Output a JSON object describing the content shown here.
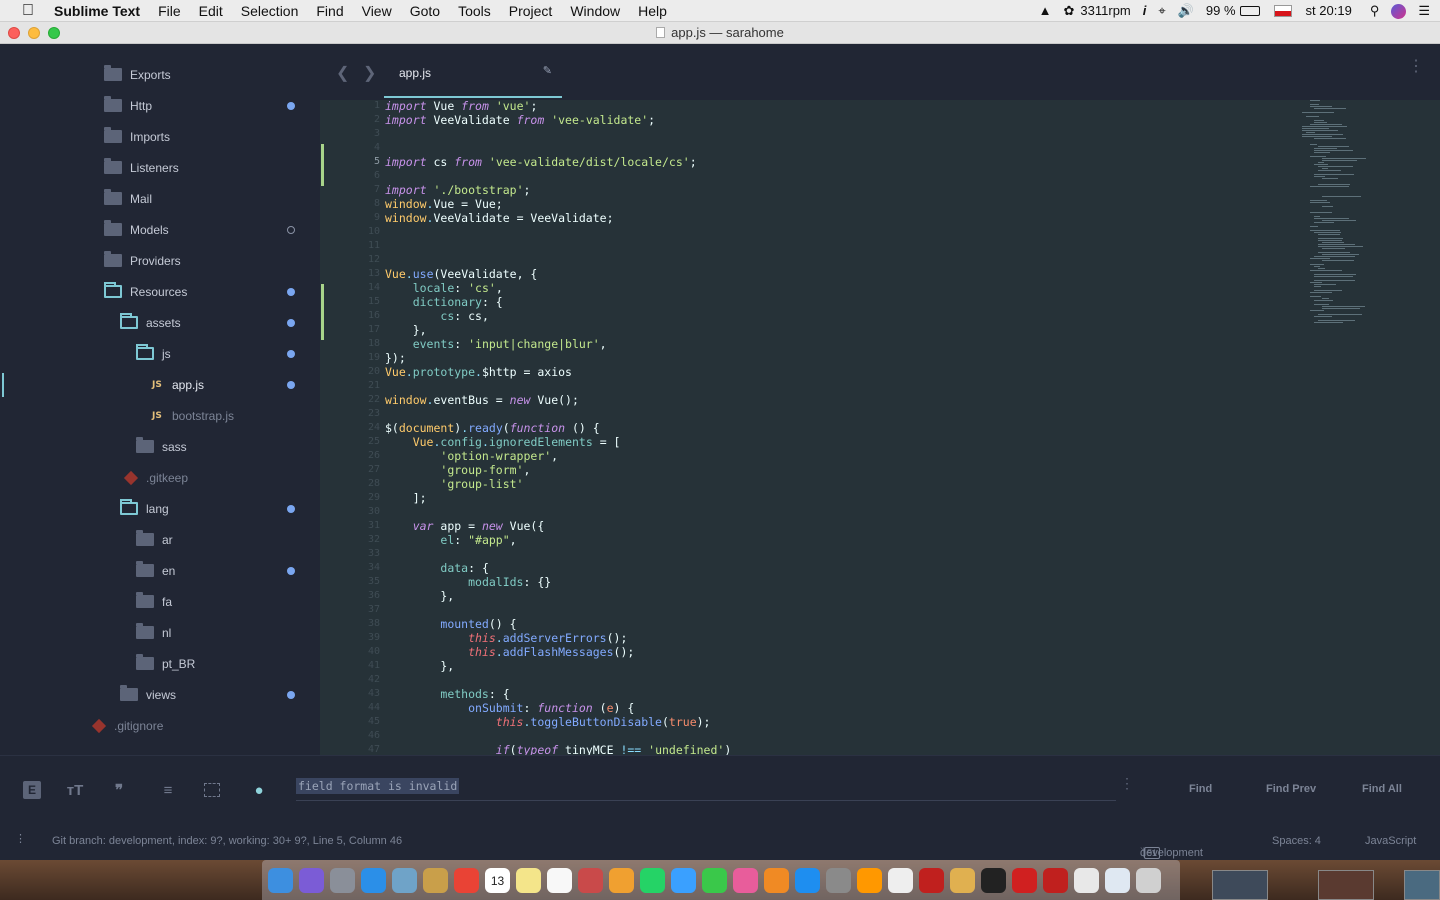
{
  "menubar": {
    "app_name": "Sublime Text",
    "items": [
      "File",
      "Edit",
      "Selection",
      "Find",
      "View",
      "Goto",
      "Tools",
      "Project",
      "Window",
      "Help"
    ],
    "fan_speed": "3311rpm",
    "battery": "99 %",
    "clock": "st 20:19"
  },
  "window": {
    "title": "app.js — sarahome"
  },
  "sidebar": {
    "items": [
      {
        "label": "Exports",
        "type": "folder",
        "depth": 0,
        "dot": ""
      },
      {
        "label": "Http",
        "type": "folder",
        "depth": 0,
        "dot": "filled"
      },
      {
        "label": "Imports",
        "type": "folder",
        "depth": 0,
        "dot": ""
      },
      {
        "label": "Listeners",
        "type": "folder",
        "depth": 0,
        "dot": ""
      },
      {
        "label": "Mail",
        "type": "folder",
        "depth": 0,
        "dot": ""
      },
      {
        "label": "Models",
        "type": "folder",
        "depth": 0,
        "dot": "hollow"
      },
      {
        "label": "Providers",
        "type": "folder",
        "depth": 0,
        "dot": ""
      },
      {
        "label": "Resources",
        "type": "folder-open",
        "depth": 0,
        "dot": "filled"
      },
      {
        "label": "assets",
        "type": "folder-open",
        "depth": 1,
        "dot": "filled"
      },
      {
        "label": "js",
        "type": "folder-open",
        "depth": 2,
        "dot": "filled"
      },
      {
        "label": "app.js",
        "type": "js",
        "depth": 3,
        "dot": "filled",
        "active": true
      },
      {
        "label": "bootstrap.js",
        "type": "js",
        "depth": 3,
        "dot": "",
        "dim": true
      },
      {
        "label": "sass",
        "type": "folder",
        "depth": 2,
        "dot": ""
      },
      {
        "label": ".gitkeep",
        "type": "git",
        "depth": 2,
        "dot": "",
        "dim": true
      },
      {
        "label": "lang",
        "type": "folder-open",
        "depth": 1,
        "dot": "filled"
      },
      {
        "label": "ar",
        "type": "folder",
        "depth": 2,
        "dot": ""
      },
      {
        "label": "en",
        "type": "folder",
        "depth": 2,
        "dot": "filled"
      },
      {
        "label": "fa",
        "type": "folder",
        "depth": 2,
        "dot": ""
      },
      {
        "label": "nl",
        "type": "folder",
        "depth": 2,
        "dot": ""
      },
      {
        "label": "pt_BR",
        "type": "folder",
        "depth": 2,
        "dot": ""
      },
      {
        "label": "views",
        "type": "folder",
        "depth": 1,
        "dot": "filled"
      },
      {
        "label": ".gitignore",
        "type": "git",
        "depth": 0,
        "dot": "",
        "dim": true
      }
    ]
  },
  "tabs": {
    "active": "app.js"
  },
  "editor": {
    "current_line": 5,
    "modified_lines": [
      4,
      5,
      6,
      14,
      15,
      16,
      17
    ],
    "lines": [
      [
        [
          "kw",
          "import"
        ],
        [
          "",
          " Vue "
        ],
        [
          "kw",
          "from"
        ],
        [
          "",
          " "
        ],
        [
          "str",
          "'vue'"
        ],
        [
          "",
          ";"
        ]
      ],
      [
        [
          "kw",
          "import"
        ],
        [
          "",
          " VeeValidate "
        ],
        [
          "kw",
          "from"
        ],
        [
          "",
          " "
        ],
        [
          "str",
          "'vee-validate'"
        ],
        [
          "",
          ";"
        ]
      ],
      [],
      [],
      [
        [
          "kw",
          "import"
        ],
        [
          "",
          " cs "
        ],
        [
          "kw",
          "from"
        ],
        [
          "",
          " "
        ],
        [
          "str",
          "'vee-validate/dist/locale/cs'"
        ],
        [
          "",
          ";"
        ]
      ],
      [],
      [
        [
          "kw",
          "import"
        ],
        [
          "",
          " "
        ],
        [
          "str",
          "'./bootstrap'"
        ],
        [
          "",
          ";"
        ]
      ],
      [
        [
          "obj",
          "window"
        ],
        [
          "pun",
          "."
        ],
        [
          "",
          "Vue = Vue;"
        ]
      ],
      [
        [
          "obj",
          "window"
        ],
        [
          "pun",
          "."
        ],
        [
          "",
          "VeeValidate = VeeValidate;"
        ]
      ],
      [],
      [],
      [],
      [
        [
          "obj",
          "Vue"
        ],
        [
          "pun",
          "."
        ],
        [
          "fn",
          "use"
        ],
        [
          "",
          "(VeeValidate, {"
        ]
      ],
      [
        [
          "",
          "    "
        ],
        [
          "prop",
          "locale"
        ],
        [
          "",
          ": "
        ],
        [
          "str",
          "'cs'"
        ],
        [
          "",
          ","
        ]
      ],
      [
        [
          "",
          "    "
        ],
        [
          "prop",
          "dictionary"
        ],
        [
          "",
          ": {"
        ]
      ],
      [
        [
          "",
          "        "
        ],
        [
          "prop",
          "cs"
        ],
        [
          "",
          ": cs,"
        ]
      ],
      [
        [
          "",
          "    },"
        ]
      ],
      [
        [
          "",
          "    "
        ],
        [
          "prop",
          "events"
        ],
        [
          "",
          ": "
        ],
        [
          "str",
          "'input|change|blur'"
        ],
        [
          "",
          ","
        ]
      ],
      [
        [
          "",
          "});"
        ]
      ],
      [
        [
          "obj",
          "Vue"
        ],
        [
          "pun",
          "."
        ],
        [
          "prop",
          "prototype"
        ],
        [
          "pun",
          "."
        ],
        [
          "",
          "$http = axios"
        ]
      ],
      [],
      [
        [
          "obj",
          "window"
        ],
        [
          "pun",
          "."
        ],
        [
          "",
          "eventBus = "
        ],
        [
          "kw",
          "new"
        ],
        [
          "",
          " Vue();"
        ]
      ],
      [],
      [
        [
          "",
          "$("
        ],
        [
          "obj",
          "document"
        ],
        [
          "",
          ")"
        ],
        [
          "pun",
          "."
        ],
        [
          "fn",
          "ready"
        ],
        [
          "",
          "("
        ],
        [
          "kw",
          "function"
        ],
        [
          "",
          " () {"
        ]
      ],
      [
        [
          "",
          "    "
        ],
        [
          "obj",
          "Vue"
        ],
        [
          "pun",
          "."
        ],
        [
          "prop",
          "config"
        ],
        [
          "pun",
          "."
        ],
        [
          "prop",
          "ignoredElements"
        ],
        [
          "",
          " = ["
        ]
      ],
      [
        [
          "",
          "        "
        ],
        [
          "str",
          "'option-wrapper'"
        ],
        [
          "",
          ","
        ]
      ],
      [
        [
          "",
          "        "
        ],
        [
          "str",
          "'group-form'"
        ],
        [
          "",
          ","
        ]
      ],
      [
        [
          "",
          "        "
        ],
        [
          "str",
          "'group-list'"
        ]
      ],
      [
        [
          "",
          "    ];"
        ]
      ],
      [],
      [
        [
          "",
          "    "
        ],
        [
          "kw",
          "var"
        ],
        [
          "",
          " app = "
        ],
        [
          "kw",
          "new"
        ],
        [
          "",
          " Vue({"
        ]
      ],
      [
        [
          "",
          "        "
        ],
        [
          "prop",
          "el"
        ],
        [
          "",
          ": "
        ],
        [
          "str",
          "\"#app\""
        ],
        [
          "",
          ","
        ]
      ],
      [],
      [
        [
          "",
          "        "
        ],
        [
          "prop",
          "data"
        ],
        [
          "",
          ": {"
        ]
      ],
      [
        [
          "",
          "            "
        ],
        [
          "prop",
          "modalIds"
        ],
        [
          "",
          ": {}"
        ]
      ],
      [
        [
          "",
          "        },"
        ]
      ],
      [],
      [
        [
          "",
          "        "
        ],
        [
          "fn",
          "mounted"
        ],
        [
          "",
          "() {"
        ]
      ],
      [
        [
          "",
          "            "
        ],
        [
          "this",
          "this"
        ],
        [
          "pun",
          "."
        ],
        [
          "fn",
          "addServerErrors"
        ],
        [
          "",
          "();"
        ]
      ],
      [
        [
          "",
          "            "
        ],
        [
          "this",
          "this"
        ],
        [
          "pun",
          "."
        ],
        [
          "fn",
          "addFlashMessages"
        ],
        [
          "",
          "();"
        ]
      ],
      [
        [
          "",
          "        },"
        ]
      ],
      [],
      [
        [
          "",
          "        "
        ],
        [
          "prop",
          "methods"
        ],
        [
          "",
          ": {"
        ]
      ],
      [
        [
          "",
          "            "
        ],
        [
          "fn",
          "onSubmit"
        ],
        [
          "",
          ": "
        ],
        [
          "kw",
          "function"
        ],
        [
          "",
          " ("
        ],
        [
          "nm",
          "e"
        ],
        [
          "",
          ") {"
        ]
      ],
      [
        [
          "",
          "                "
        ],
        [
          "this",
          "this"
        ],
        [
          "pun",
          "."
        ],
        [
          "fn",
          "toggleButtonDisable"
        ],
        [
          "",
          "("
        ],
        [
          "nm",
          "true"
        ],
        [
          "",
          ");"
        ]
      ],
      [],
      [
        [
          "",
          "                "
        ],
        [
          "kw",
          "if"
        ],
        [
          "",
          "("
        ],
        [
          "kw",
          "typeof"
        ],
        [
          "",
          " tinyMCE "
        ],
        [
          "pun",
          "!=="
        ],
        [
          "",
          " "
        ],
        [
          "str",
          "'undefined'"
        ],
        [
          "",
          ")"
        ]
      ]
    ]
  },
  "find": {
    "query": "field format is invalid",
    "buttons": [
      "Find",
      "Find Prev",
      "Find All"
    ]
  },
  "status": {
    "git": "Git branch: development, index: 9?, working: 30+ 9?, Line 5, Column 46",
    "branch": "development",
    "branch_badge": "51",
    "spaces": "Spaces: 4",
    "syntax": "JavaScript"
  },
  "colors": {
    "accent": "#7ec8d4",
    "dot": "#7aa6f0",
    "editor_bg": "#263238",
    "sidebar_bg": "#212634"
  },
  "dock": {
    "apps": [
      "finder",
      "siri",
      "launchpad",
      "safari",
      "preview",
      "notes-app",
      "chrome",
      "calendar",
      "stickies",
      "reminders",
      "photo-booth",
      "photos",
      "whatsapp",
      "messages",
      "facetime",
      "itunes",
      "books",
      "app-store",
      "system-preferences",
      "sublime-text",
      "textedit",
      "filezilla",
      "sequel",
      "terminal",
      "adblock",
      "filezilla-alt",
      "mail-folder",
      "folder",
      "trash"
    ],
    "calendar_day": "13"
  }
}
